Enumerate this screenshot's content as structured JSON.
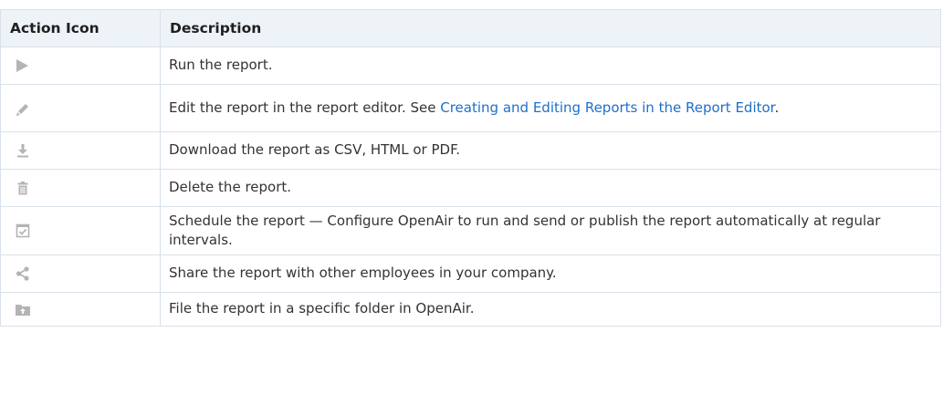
{
  "table": {
    "headers": {
      "action_icon": "Action Icon",
      "description": "Description"
    },
    "rows": [
      {
        "icon": "play-icon",
        "text": "Run the report."
      },
      {
        "icon": "pencil-icon",
        "text_before": "Edit the report in the report editor. See ",
        "link": "Creating and Editing Reports in the Report Editor",
        "text_after": "."
      },
      {
        "icon": "download-icon",
        "text": "Download the report as CSV, HTML or PDF."
      },
      {
        "icon": "trash-icon",
        "text": "Delete the report."
      },
      {
        "icon": "calendar-check-icon",
        "text": "Schedule the report — Configure OpenAir to run and send or publish the report automatically at regular intervals."
      },
      {
        "icon": "share-icon",
        "text": "Share the report with other employees in your company."
      },
      {
        "icon": "folder-icon",
        "text": "File the report in a specific folder in OpenAir."
      }
    ]
  },
  "colors": {
    "icon": "#b4b4b4",
    "link": "#1f6fc9",
    "header_bg": "#eef3f8",
    "border": "#d9e1ea"
  }
}
